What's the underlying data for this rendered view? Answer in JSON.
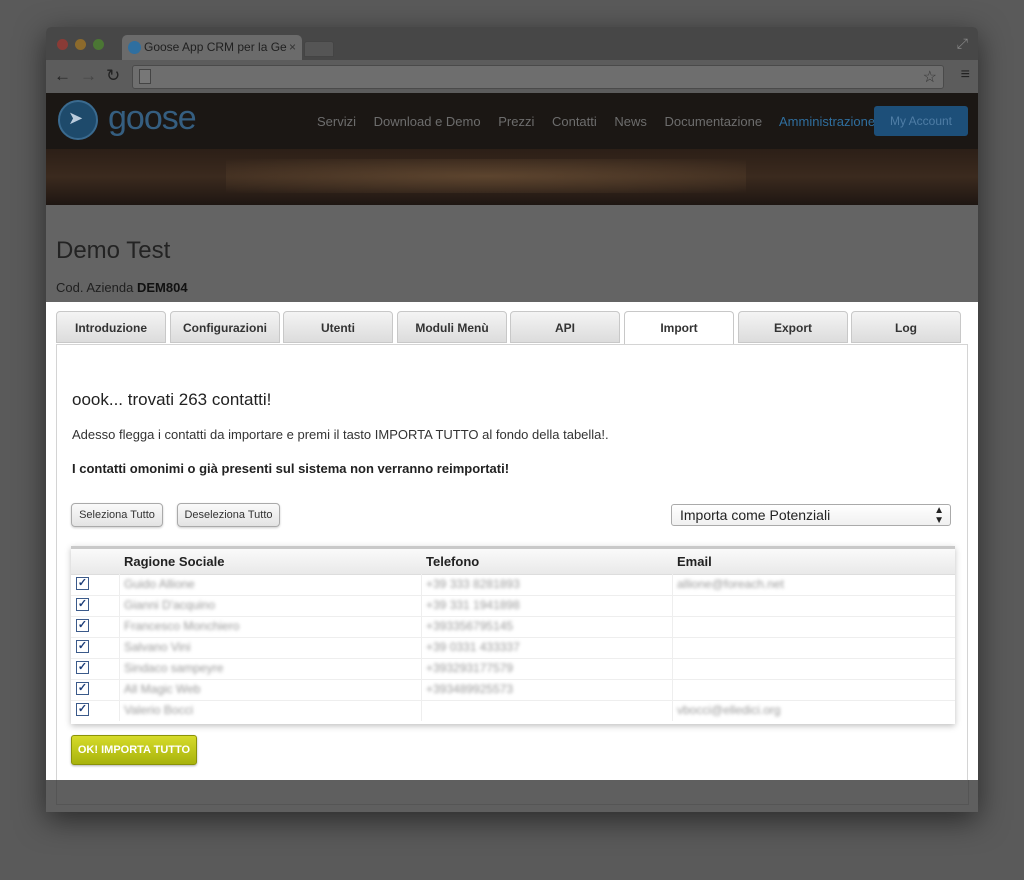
{
  "browser": {
    "tab_title": "Goose App CRM per la Ge",
    "tab_close": "×",
    "expand": "⤢"
  },
  "site": {
    "logo_text": "goose",
    "nav": [
      "Servizi",
      "Download e Demo",
      "Prezzi",
      "Contatti",
      "News",
      "Documentazione",
      "Amministrazione"
    ],
    "nav_active": "Amministrazione",
    "account_label": "My Account"
  },
  "page": {
    "title": "Demo Test",
    "cod_label": "Cod. Azienda",
    "cod_value": "DEM804"
  },
  "tabs": [
    "Introduzione",
    "Configurazioni",
    "Utenti",
    "Moduli Menù",
    "API",
    "Import",
    "Export",
    "Log"
  ],
  "active_tab": "Import",
  "import": {
    "found_text": "oook... trovati 263 contatti!",
    "instructions": "Adesso flegga i contatti da importare e premi il tasto IMPORTA TUTTO al fondo della tabella!.",
    "warning": "I contatti omonimi o già presenti sul sistema non verranno reimportati!",
    "select_all": "Seleziona Tutto",
    "deselect_all": "Deseleziona Tutto",
    "import_as": "Importa come Potenziali",
    "import_button": "OK! IMPORTA TUTTO"
  },
  "table": {
    "headers": [
      "Ragione Sociale",
      "Telefono",
      "Email"
    ],
    "rows": [
      {
        "name": "Guido Allione",
        "phone": "+39 333 8281893",
        "email": "allione@foreach.net"
      },
      {
        "name": "Gianni D'acquino",
        "phone": "+39 331 1941898",
        "email": ""
      },
      {
        "name": "Francesco Monchiero",
        "phone": "+393356795145",
        "email": ""
      },
      {
        "name": "Salvano Vini",
        "phone": "+39 0331 433337",
        "email": ""
      },
      {
        "name": "Sindaco sampeyre",
        "phone": "+393293177579",
        "email": ""
      },
      {
        "name": "All Magic Web",
        "phone": "+393489925573",
        "email": ""
      },
      {
        "name": "Valerio Bocci",
        "phone": "",
        "email": "vbocci@elledici.org"
      }
    ]
  }
}
